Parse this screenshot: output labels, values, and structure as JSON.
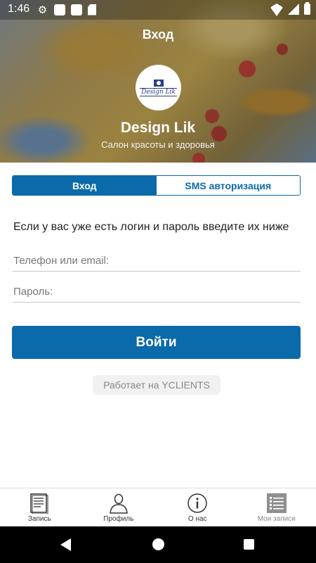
{
  "status_bar": {
    "time": "1:46"
  },
  "header": {
    "title": "Вход",
    "logo_text": "Design Lik",
    "salon_name": "Design Lik",
    "salon_subtitle": "Салон красоты и здоровья"
  },
  "tabs": [
    {
      "label": "Вход",
      "active": true
    },
    {
      "label": "SMS авторизация",
      "active": false
    }
  ],
  "form": {
    "instructions": "Если у вас уже есть логин и пароль введите их ниже",
    "login_placeholder": "Телефон или email:",
    "password_placeholder": "Пароль:",
    "submit_label": "Войти"
  },
  "powered_by": "Работает на YCLIENTS",
  "bottom_nav": [
    {
      "label": "Запись",
      "icon": "document-icon"
    },
    {
      "label": "Профиль",
      "icon": "person-icon"
    },
    {
      "label": "О нас",
      "icon": "info-icon"
    },
    {
      "label": "Мои записи",
      "icon": "list-icon"
    }
  ],
  "colors": {
    "accent": "#0b6aa9",
    "tab_inactive_text": "#0b6aa9"
  }
}
